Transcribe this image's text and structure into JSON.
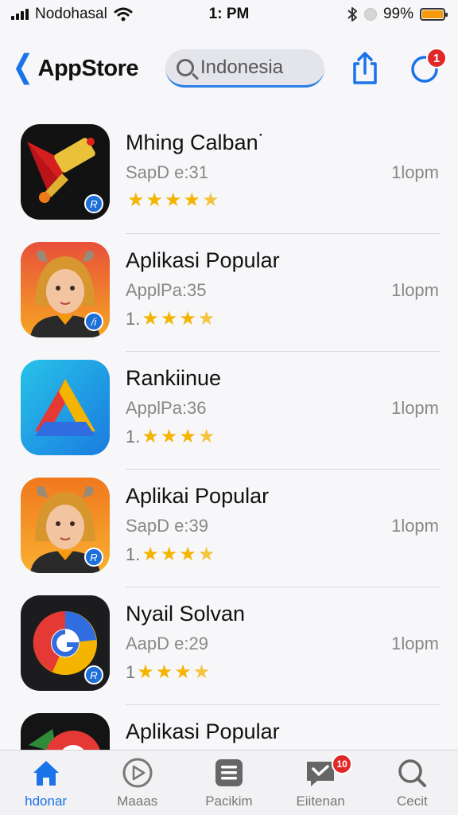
{
  "status_bar": {
    "carrier": "Nodohasal",
    "time": "1: PM",
    "battery": "99%",
    "battery_level": 0.99
  },
  "nav": {
    "back_label": "AppStore",
    "search_value": "Indonesia",
    "badge_count": "1"
  },
  "apps": [
    {
      "title": "Mhing Calban˙",
      "subtitle": "SapD e:31",
      "time": "1lopm",
      "rating_prefix": "",
      "icon": "megaphone-icon"
    },
    {
      "title": "Aplikasi Popular",
      "subtitle": "ApplPa:35",
      "time": "1lopm",
      "rating_prefix": "1.",
      "icon": "avatar-girl-icon"
    },
    {
      "title": "Rankiinue",
      "subtitle": "ApplPa:36",
      "time": "1lopm",
      "rating_prefix": "1.",
      "icon": "drive-triangle-icon"
    },
    {
      "title": "Aplikai Popular",
      "subtitle": "SapD e:39",
      "time": "1lopm",
      "rating_prefix": "1.",
      "icon": "avatar-girl-icon"
    },
    {
      "title": "Nyail Solvan",
      "subtitle": "AapD e:29",
      "time": "1lopm",
      "rating_prefix": "1",
      "icon": "chrome-g-icon"
    },
    {
      "title": "Aplikasi Popular",
      "subtitle": "",
      "time": "",
      "rating_prefix": "",
      "icon": "red-circle-icon"
    }
  ],
  "tabs": [
    {
      "label": "hdonar",
      "icon": "home-icon",
      "active": true
    },
    {
      "label": "Maaas",
      "icon": "play-icon",
      "active": false
    },
    {
      "label": "Pacikim",
      "icon": "list-icon",
      "active": false
    },
    {
      "label": "Eiitenan",
      "icon": "message-icon",
      "active": false,
      "badge": "10"
    },
    {
      "label": "Cecit",
      "icon": "search-icon",
      "active": false
    }
  ],
  "colors": {
    "accent": "#1a73e8",
    "badge": "#e02828",
    "star": "#f4b400",
    "battery": "#f59a0c"
  }
}
